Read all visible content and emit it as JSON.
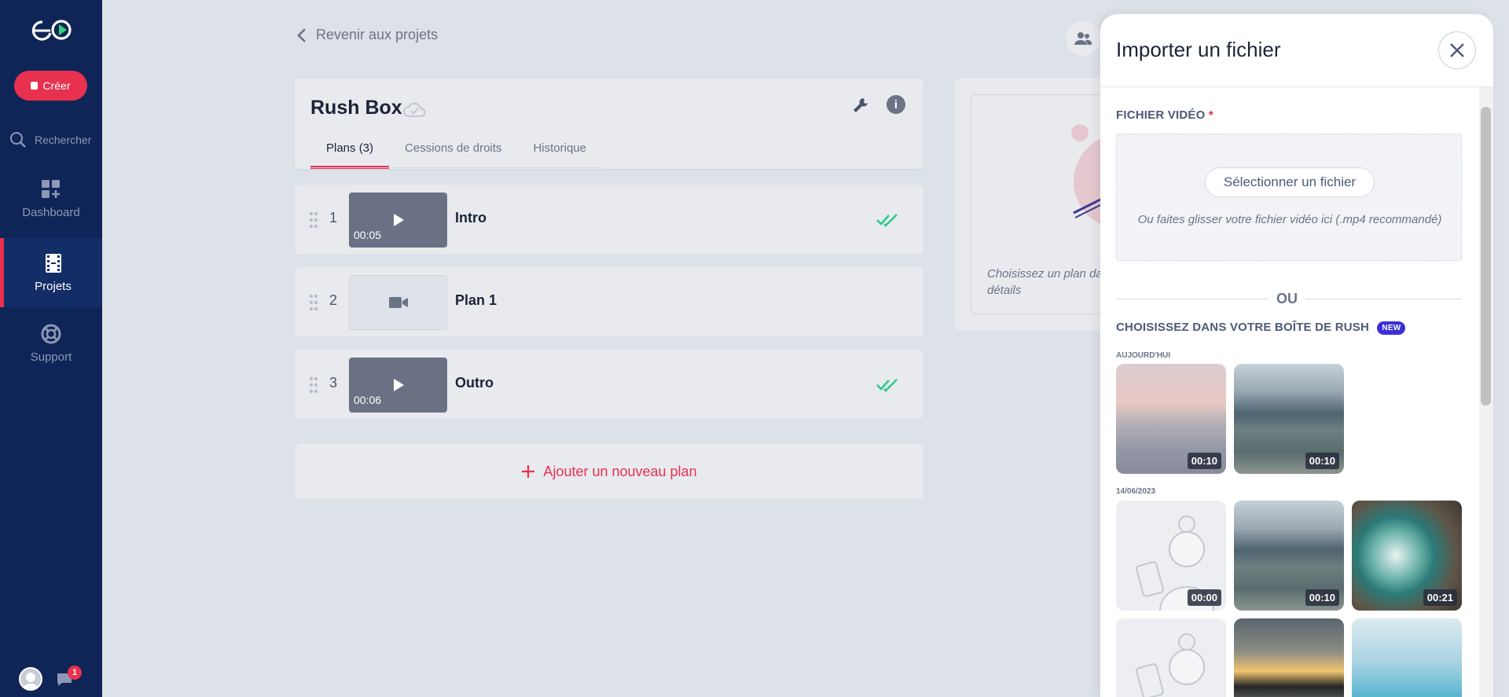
{
  "sidebar": {
    "create_label": "Créer",
    "search_label": "Rechercher",
    "items": [
      {
        "label": "Dashboard"
      },
      {
        "label": "Projets"
      },
      {
        "label": "Support"
      }
    ],
    "notification_count": "1"
  },
  "header": {
    "back_label": "Revenir aux projets"
  },
  "project": {
    "title": "Rush Box",
    "tabs": [
      {
        "label": "Plans (3)"
      },
      {
        "label": "Cessions de droits"
      },
      {
        "label": "Historique"
      }
    ]
  },
  "plans": [
    {
      "number": "1",
      "name": "Intro",
      "duration": "00:05"
    },
    {
      "number": "2",
      "name": "Plan 1",
      "duration": ""
    },
    {
      "number": "3",
      "name": "Outro",
      "duration": "00:06"
    }
  ],
  "add_plan_label": "Ajouter un nouveau plan",
  "detail_hint": "Choisissez un plan da détails",
  "panel": {
    "title": "Importer un fichier",
    "video_label": "FICHIER VIDÉO",
    "required_mark": "*",
    "select_button": "Sélectionner un fichier",
    "drop_hint": "Ou faites glisser votre fichier vidéo ici (.mp4 recommandé)",
    "or_label": "OU",
    "rush_label": "CHOISISSEZ DANS VOTRE BOÎTE DE RUSH",
    "new_badge": "NEW",
    "groups": [
      {
        "date": "AUJOURD'HUI",
        "items": [
          {
            "duration": "00:10"
          },
          {
            "duration": "00:10"
          }
        ]
      },
      {
        "date": "14/06/2023",
        "items": [
          {
            "duration": "00:00"
          },
          {
            "duration": "00:10"
          },
          {
            "duration": "00:21"
          }
        ]
      }
    ]
  },
  "colors": {
    "sidebar": "#0f2557",
    "accent": "#e8304f",
    "check": "#2fc98a",
    "new_badge": "#3b2fd6"
  }
}
